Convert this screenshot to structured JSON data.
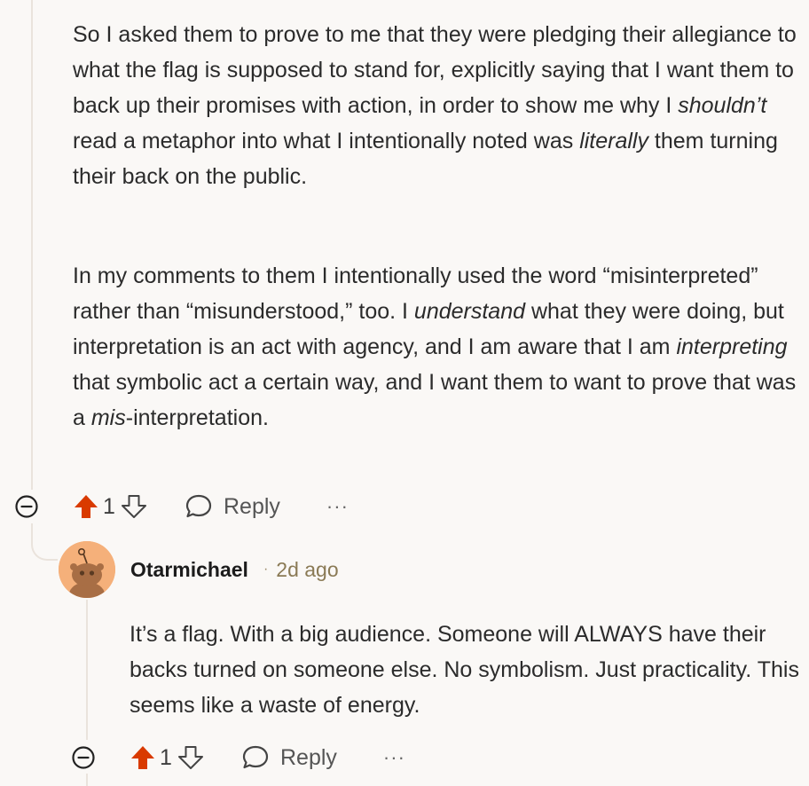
{
  "comment1": {
    "paragraph1": [
      {
        "t": "So I asked them to prove to me that they were pledging their allegiance to what the flag is supposed to stand for, explicitly saying that I want them to back up their promises with action, in order to show me why I "
      },
      {
        "t": "shouldn’t",
        "em": true
      },
      {
        "t": " read a metaphor into what I intentionally noted was "
      },
      {
        "t": "literally",
        "em": true
      },
      {
        "t": " them turning their back on the public."
      }
    ],
    "paragraph2": [
      {
        "t": "In my comments to them I intentionally used the word “misinterpreted” rather than “misunderstood,” too. I "
      },
      {
        "t": "understand",
        "em": true
      },
      {
        "t": " what they were doing, but interpretation is an act with agency, and I am aware that I am "
      },
      {
        "t": "interpreting",
        "em": true
      },
      {
        "t": " that symbolic act a certain way, and I want them to want to prove that was a "
      },
      {
        "t": "mis",
        "em": true
      },
      {
        "t": "-interpretation."
      }
    ],
    "actions": {
      "vote_count": "1",
      "reply_label": "Reply",
      "more_label": "···"
    }
  },
  "reply": {
    "author": "Otarmichael",
    "separator": "·",
    "age": "2d ago",
    "avatar_color": "#f5b07a",
    "text": "It’s a flag. With a big audience. Someone will ALWAYS have their backs turned on someone else. No symbolism. Just practicality. This seems like a waste of energy.",
    "actions": {
      "vote_count": "1",
      "reply_label": "Reply",
      "more_label": "···"
    }
  },
  "colors": {
    "upvote_active": "#d93a00",
    "background": "#faf8f6",
    "thread_line": "#eae3dc"
  },
  "icons": [
    "collapse-icon",
    "upvote-icon",
    "downvote-icon",
    "reply-icon",
    "more-icon",
    "avatar-icon"
  ]
}
